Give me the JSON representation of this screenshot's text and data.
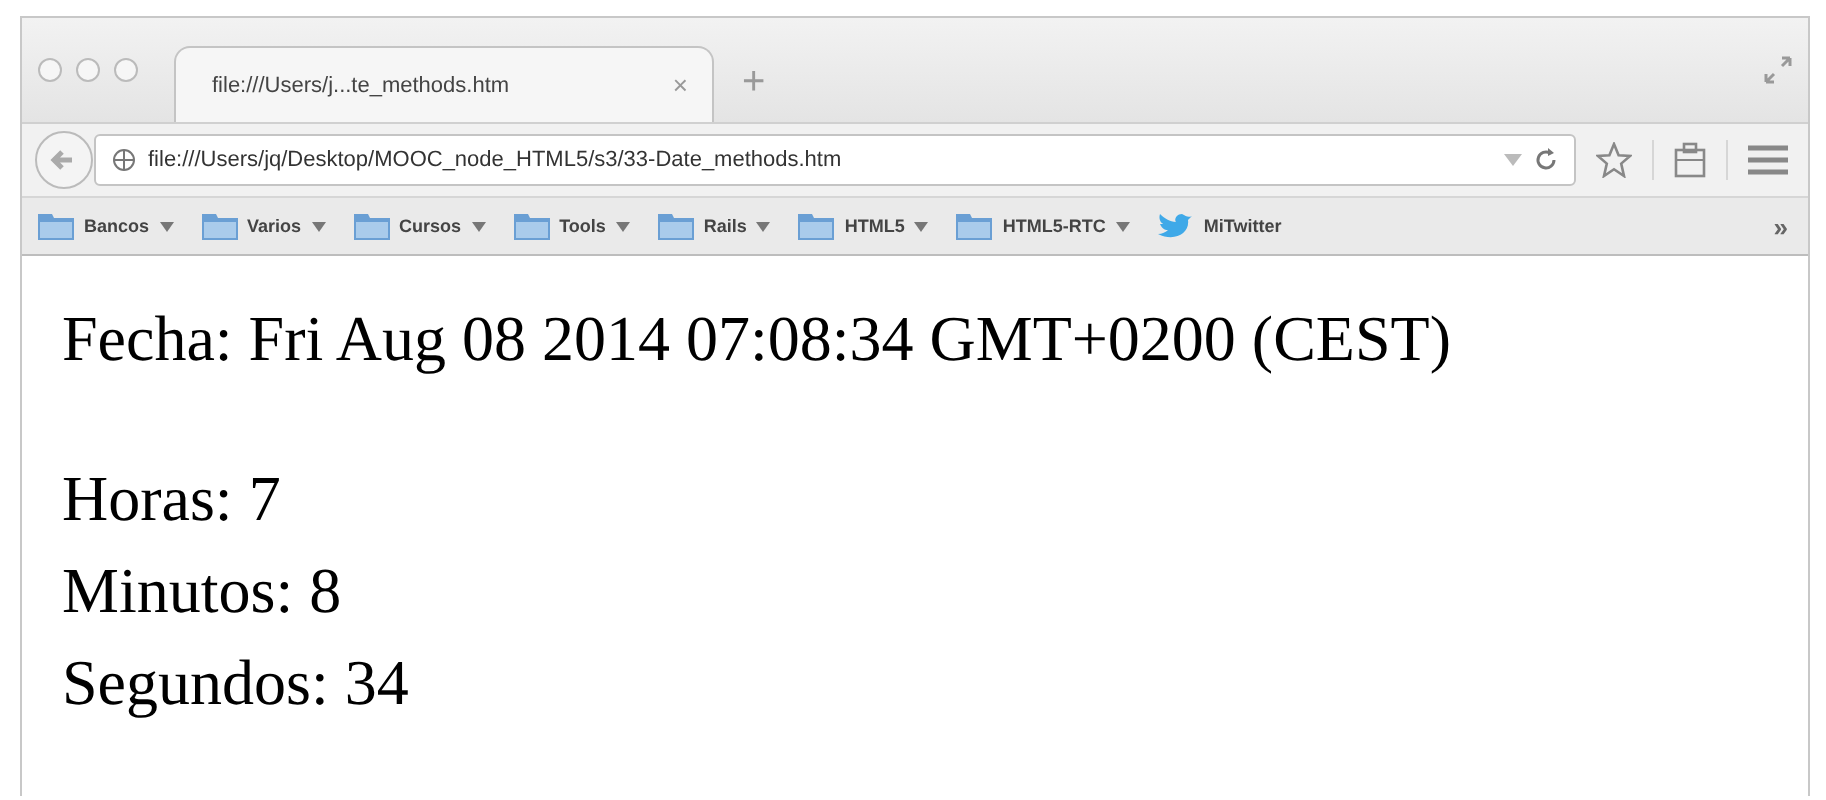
{
  "window": {
    "tab": {
      "title": "file:///Users/j...te_methods.htm",
      "close": "×",
      "selected": true
    },
    "new_tab": "+"
  },
  "address_bar": {
    "url": "file:///Users/jq/Desktop/MOOC_node_HTML5/s3/33-Date_methods.htm"
  },
  "bookmarks": [
    {
      "label": "Bancos",
      "kind": "folder"
    },
    {
      "label": "Varios",
      "kind": "folder"
    },
    {
      "label": "Cursos",
      "kind": "folder"
    },
    {
      "label": "Tools",
      "kind": "folder"
    },
    {
      "label": "Rails",
      "kind": "folder"
    },
    {
      "label": "HTML5",
      "kind": "folder"
    },
    {
      "label": "HTML5-RTC",
      "kind": "folder"
    },
    {
      "label": "MiTwitter",
      "kind": "bird"
    }
  ],
  "bookmarks_more": "»",
  "content": {
    "date_line": "Fecha: Fri Aug 08 2014 07:08:34 GMT+0200 (CEST)",
    "lines": [
      "Horas: 7",
      "Minutos: 8",
      "Segundos: 34"
    ]
  }
}
